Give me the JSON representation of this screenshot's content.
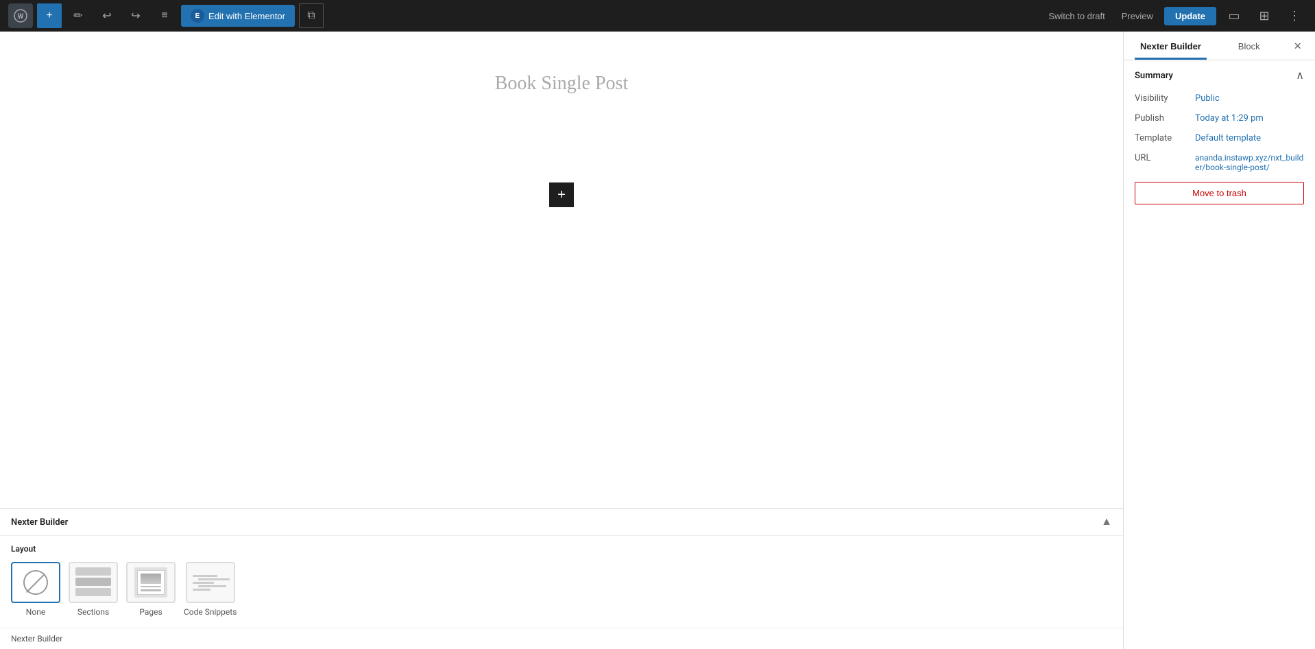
{
  "toolbar": {
    "add_label": "+",
    "edit_icon": "✏",
    "undo_icon": "↩",
    "redo_icon": "↪",
    "list_icon": "≡",
    "elementor_logo": "E",
    "edit_elementor_label": "Edit with Elementor",
    "copy_icon": "⧉",
    "switch_to_draft_label": "Switch to draft",
    "preview_label": "Preview",
    "update_label": "Update",
    "view_icon": "▭",
    "block_icon": "⊞",
    "more_icon": "⋮"
  },
  "canvas": {
    "page_title": "Book Single Post",
    "add_block_icon": "+"
  },
  "bottom_panel": {
    "title": "Nexter Builder",
    "collapse_icon": "▲",
    "layout_label": "Layout",
    "layout_options": [
      {
        "id": "none",
        "label": "None",
        "selected": true
      },
      {
        "id": "sections",
        "label": "Sections",
        "selected": false
      },
      {
        "id": "pages",
        "label": "Pages",
        "selected": false
      },
      {
        "id": "code_snippets",
        "label": "Code Snippets",
        "selected": false
      }
    ],
    "footer_title": "Nexter Builder"
  },
  "sidebar": {
    "tab_nexter_builder": "Nexter Builder",
    "tab_block": "Block",
    "close_icon": "×",
    "summary": {
      "title": "Summary",
      "collapse_icon": "∧",
      "visibility_label": "Visibility",
      "visibility_value": "Public",
      "publish_label": "Publish",
      "publish_value": "Today at 1:29 pm",
      "template_label": "Template",
      "template_value": "Default template",
      "url_label": "URL",
      "url_value": "ananda.instawp.xyz/nxt_builder/book-single-post/",
      "move_to_trash_label": "Move to trash"
    }
  }
}
